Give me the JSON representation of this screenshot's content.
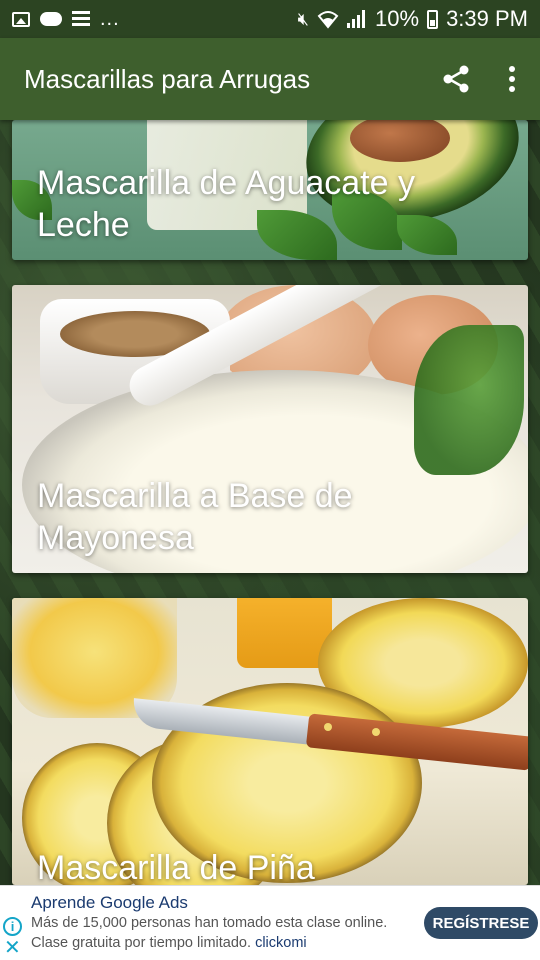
{
  "status_bar": {
    "battery": "10%",
    "time": "3:39 PM",
    "left_icons": [
      "image-icon",
      "cloud-icon",
      "list-icon"
    ],
    "overflow": "..."
  },
  "app_bar": {
    "title": "Mascarillas para Arrugas",
    "actions": [
      "share-icon",
      "more-vert-icon"
    ]
  },
  "cards": [
    {
      "label": "Mascarilla de Aguacate y Leche"
    },
    {
      "label": "Mascarilla a Base de Mayonesa"
    },
    {
      "label": "Mascarilla de Piña"
    }
  ],
  "ad": {
    "title": "Aprende Google Ads",
    "line1": "Más de 15,000 personas han tomado esta clase online.",
    "line2": "Clase gratuita por tiempo limitado.",
    "brand": "clickomi",
    "cta": "REGÍSTRESE"
  },
  "colors": {
    "status_bar": "#2c4422",
    "app_bar": "#3e5f2d",
    "ad_cta": "#2f4a66",
    "ad_icon": "#14a5c8"
  }
}
